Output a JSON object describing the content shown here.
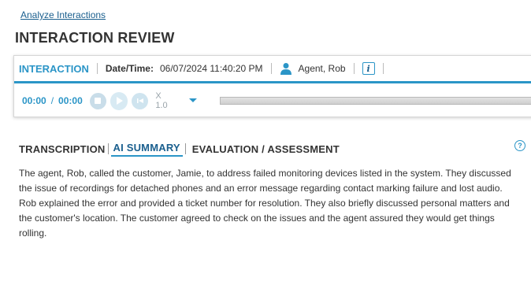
{
  "breadcrumb": {
    "link": "Analyze Interactions"
  },
  "page_title": "INTERACTION REVIEW",
  "interaction": {
    "header": "INTERACTION",
    "datetime_label": "Date/Time:",
    "datetime_value": "06/07/2024 11:40:20 PM",
    "agent_name": "Agent, Rob",
    "info_icon": "info-icon",
    "agent_icon": "person-icon"
  },
  "player": {
    "current_time": "00:00",
    "separator": "/",
    "total_time": "00:00",
    "speed": "X 1.0",
    "progress": 0,
    "icons": [
      "stop-icon",
      "play-icon",
      "rewind-icon",
      "chevron-down-icon"
    ]
  },
  "tabs": [
    {
      "label": "TRANSCRIPTION",
      "active": false
    },
    {
      "label": "AI SUMMARY",
      "active": true
    },
    {
      "label": "EVALUATION / ASSESSMENT",
      "active": false
    }
  ],
  "help_icon": "help-icon",
  "summary_text": "The agent, Rob, called the customer, Jamie, to address failed monitoring devices listed in the system. They discussed the issue of recordings for detached phones and an error message regarding contact marking failure and lost audio. Rob explained the error and provided a ticket number for resolution. They also briefly discussed personal matters and the customer's location. The customer agreed to check on the issues and the agent assured they would get things rolling.",
  "colors": {
    "accent": "#2b95c7",
    "link": "#1a5f8e",
    "text": "#333333"
  }
}
